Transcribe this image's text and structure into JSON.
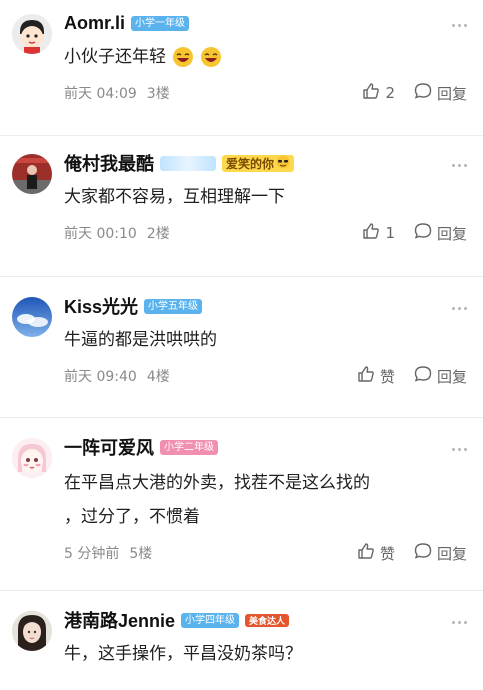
{
  "colors": {
    "level_blue": "#5bb3ee",
    "level_pink": "#f18fb1",
    "meta_gray": "#8a8a8a"
  },
  "comments": [
    {
      "username": "Aomr.li",
      "level": "小学一年级",
      "text": "小伙子还年轻",
      "emoji": [
        "laughing-face",
        "laughing-face"
      ],
      "time": "前天 04:09",
      "floor": "3楼",
      "like_count": "2",
      "reply_label": "回复"
    },
    {
      "username": "俺村我最酷",
      "decor_badge": "爱笑的你",
      "text": "大家都不容易，互相理解一下",
      "time": "前天 00:10",
      "floor": "2楼",
      "like_count": "1",
      "reply_label": "回复"
    },
    {
      "username": "Kiss光光",
      "level": "小学五年级",
      "text": "牛逼的都是洪哄哄的",
      "time": "前天 09:40",
      "floor": "4楼",
      "like_label": "赞",
      "reply_label": "回复"
    },
    {
      "username": "一阵可爱风",
      "level": "小学二年级",
      "text_line1": "在平昌点大港的外卖，找茬不是这么找的",
      "text_line2": "，过分了，不惯着",
      "time": "5 分钟前",
      "floor": "5楼",
      "like_label": "赞",
      "reply_label": "回复"
    },
    {
      "username": "港南路Jennie",
      "level": "小学四年级",
      "decor_badge": "美食达人",
      "text": "牛，这手操作，平昌没奶茶吗？"
    }
  ]
}
